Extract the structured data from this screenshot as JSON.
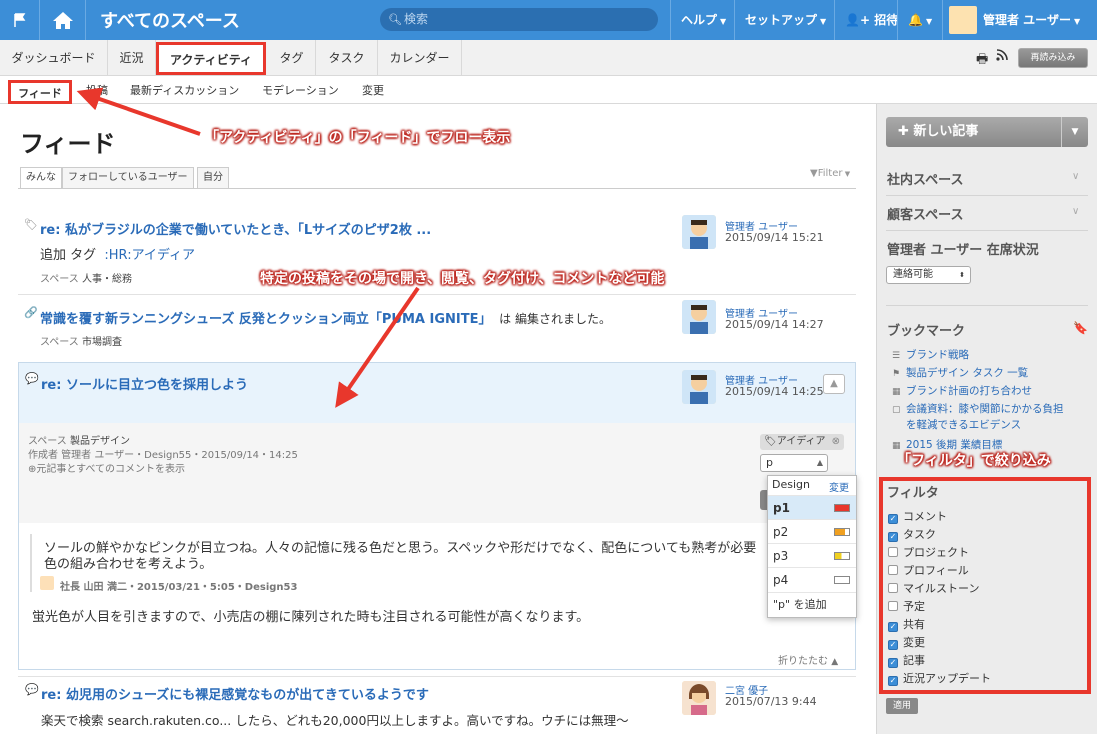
{
  "topbar": {
    "space_title": "すべてのスペース",
    "search_placeholder": "検索",
    "help": "ヘルプ",
    "setup": "セットアップ",
    "invite": "招待",
    "user": "管理者 ユーザー"
  },
  "tabs": [
    "ダッシュボード",
    "近況",
    "アクティビティ",
    "タグ",
    "タスク",
    "カレンダー"
  ],
  "reload_label": "再読み込み",
  "subtabs": [
    "フィード",
    "投稿",
    "最新ディスカッション",
    "モデレーション",
    "変更"
  ],
  "feed": {
    "title": "フィード",
    "filter_tabs": [
      "みんな",
      "フォローしているユーザー",
      "自分"
    ],
    "filter_link": "Filter",
    "posts": [
      {
        "title": "re: 私がブラジルの企業で働いていたとき、「Lサイズのピザ2枚 ...",
        "line": "追加 タグ",
        "tag": ":HR:アイディア",
        "space_label": "スペース",
        "space": "人事・総務",
        "author": "管理者 ユーザー",
        "date": "2015/09/14 15:21"
      },
      {
        "title": "常識を覆す新ランニングシューズ 反発とクッション両立「PUMA IGNITE」",
        "suffix_pre": "は",
        "suffix": "編集されました。",
        "space_label": "スペース",
        "space": "市場調査",
        "author": "管理者 ユーザー",
        "date": "2015/09/14 14:27"
      }
    ],
    "expanded": {
      "title": "re: ソールに目立つ色を採用しよう",
      "author": "管理者 ユーザー",
      "date": "2015/09/14 14:25",
      "space_label": "スペース",
      "space": "製品デザイン",
      "creator": "作成者 管理者 ユーザー・Design55・2015/09/14・14:25",
      "show_all": "元記事とすべてのコメントを表示",
      "tag_chip": "アイディア",
      "tag_input": "p",
      "quote_1": "ソールの鮮やかなピンクが目立つね。人々の記憶に残る色だと思う。スペックや形だけでなく、配色についても熟考が必要",
      "quote_2": "色の組み合わせを考えよう。",
      "quote_meta": "社長 山田 満二・2015/03/21・5:05・Design53",
      "comment": "蛍光色が人目を引きますので、小売店の棚に陳列された時も注目される可能性が高くなります。",
      "collapse": "折りたたむ"
    },
    "dropdown": {
      "group": "Design",
      "change": "変更",
      "options": [
        "p1",
        "p2",
        "p3",
        "p4"
      ],
      "swatch_colors": [
        "#e8372c",
        "#f0a020",
        "#f0d020",
        "#ffffff"
      ],
      "add": "\"p\" を追加"
    },
    "post_last": {
      "title": "re: 幼児用のシューズにも裸足感覚なものが出てきているようです",
      "body": "楽天で検索 search.rakuten.co...  したら、どれも20,000円以上しますよ。高いですね。ウチには無理〜",
      "author": "二宮 優子",
      "date": "2015/07/13 9:44"
    }
  },
  "sidebar": {
    "new_post": "新しい記事",
    "section_internal": "社内スペース",
    "section_customer": "顧客スペース",
    "status_title": "管理者 ユーザー 在席状況",
    "status_value": "連絡可能",
    "bookmarks_title": "ブックマーク",
    "bookmarks": [
      "ブランド戦略",
      "製品デザイン タスク 一覧",
      "ブランド計画の打ち合わせ",
      "会議資料：膝や関節にかかる負担",
      "を軽減できるエビデンス",
      "2015 後期 業績目標"
    ],
    "filter_title": "フィルタ",
    "filters": [
      {
        "label": "コメント",
        "checked": true
      },
      {
        "label": "タスク",
        "checked": true
      },
      {
        "label": "プロジェクト",
        "checked": false
      },
      {
        "label": "プロフィール",
        "checked": false
      },
      {
        "label": "マイルストーン",
        "checked": false
      },
      {
        "label": "予定",
        "checked": false
      },
      {
        "label": "共有",
        "checked": true
      },
      {
        "label": "変更",
        "checked": true
      },
      {
        "label": "記事",
        "checked": true
      },
      {
        "label": "近況アップデート",
        "checked": true
      }
    ],
    "apply": "適用"
  },
  "annotations": {
    "feed_note": "「アクティビティ」の「フィード」でフロー表示",
    "inline_note": "特定の投稿をその場で開き、閲覧、タグ付け、コメントなど可能",
    "filter_note": "「フィルタ」で絞り込み"
  },
  "colors": {
    "brand": "#3c8ed7",
    "link": "#2a6bb8",
    "annotation": "#e8372c"
  }
}
